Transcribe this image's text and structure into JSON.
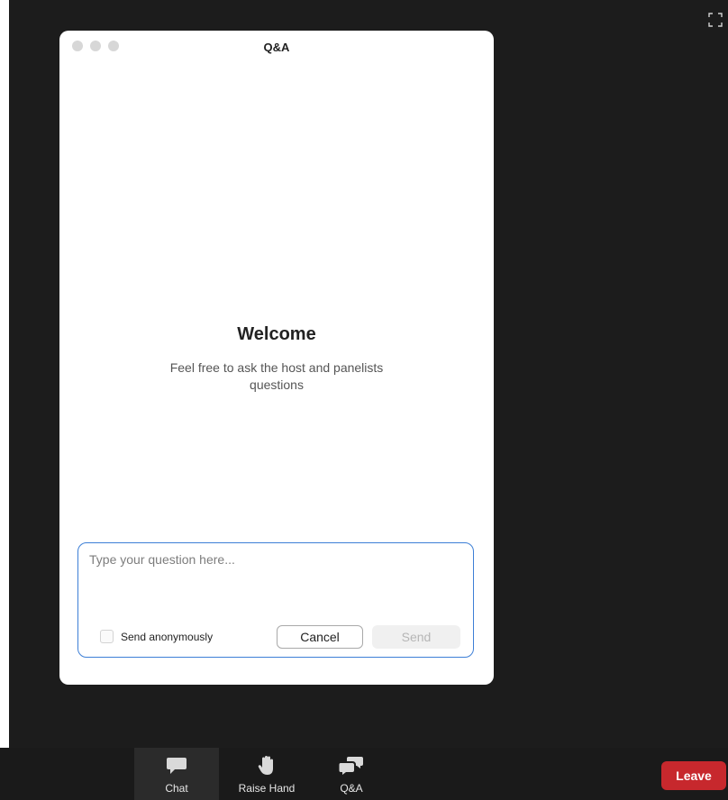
{
  "dialog": {
    "title": "Q&A",
    "welcome_title": "Welcome",
    "welcome_subtitle": "Feel free to ask the host and panelists questions",
    "question_placeholder": "Type your question here...",
    "question_value": "",
    "anonymous_label": "Send anonymously",
    "cancel_label": "Cancel",
    "send_label": "Send"
  },
  "toolbar": {
    "items": [
      {
        "label": "Chat",
        "icon": "chat-bubble-icon"
      },
      {
        "label": "Raise Hand",
        "icon": "hand-icon"
      },
      {
        "label": "Q&A",
        "icon": "qa-bubbles-icon"
      }
    ],
    "leave_label": "Leave"
  },
  "colors": {
    "accent_blue": "#3d7fd6",
    "leave_red": "#c7282d",
    "background": "#1c1c1c"
  }
}
